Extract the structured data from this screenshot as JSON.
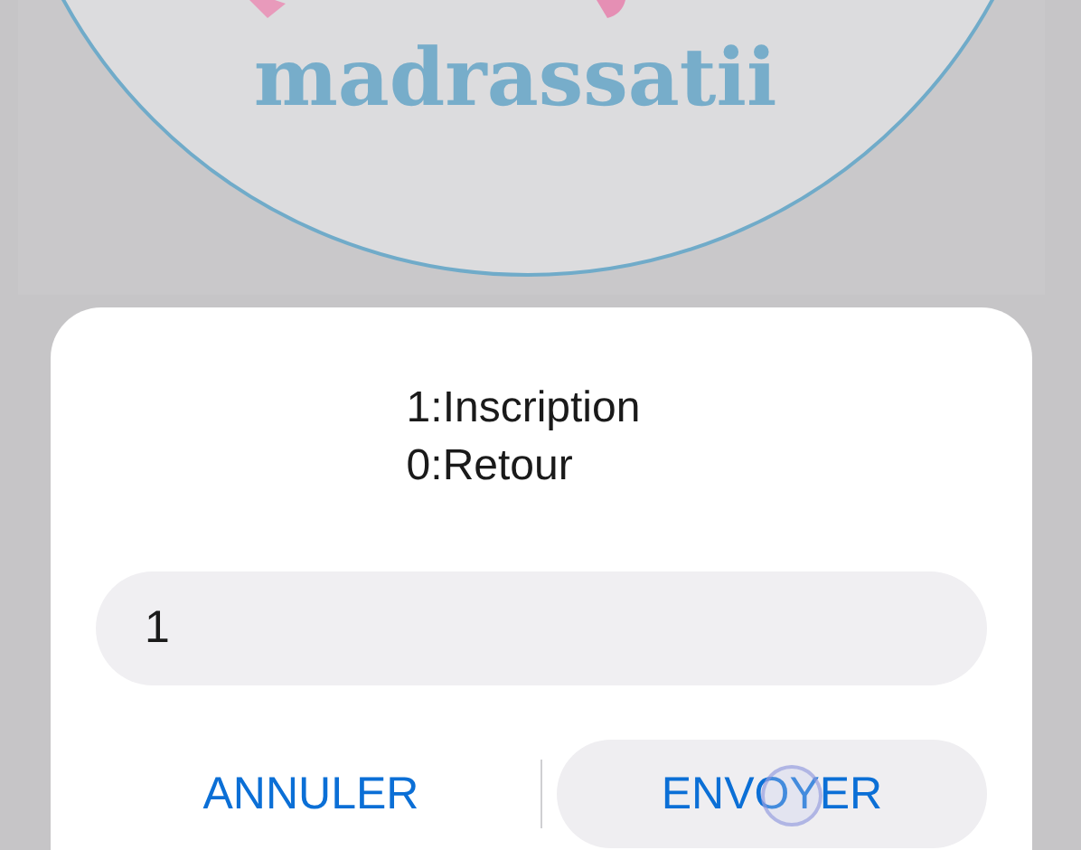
{
  "header": {
    "logo_text": "madrassatii"
  },
  "dialog": {
    "message_lines": [
      "1:Inscription",
      "0:Retour"
    ],
    "input": {
      "value": "1"
    },
    "buttons": [
      {
        "label": "ANNULER",
        "pressed": false
      },
      {
        "label": "ENVOYER",
        "pressed": true
      }
    ]
  }
}
